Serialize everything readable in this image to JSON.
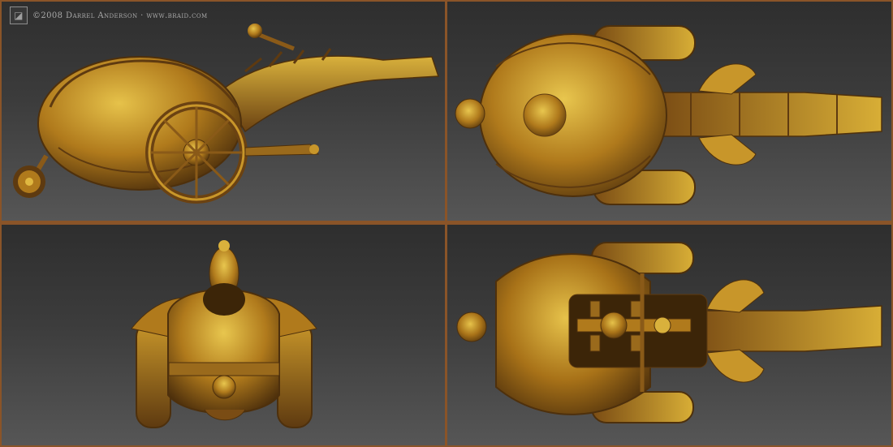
{
  "credit": {
    "copyright": "©2008 Darrel Anderson · www.braid.com"
  },
  "views": [
    {
      "id": "side",
      "icon": "vehicle-side-view"
    },
    {
      "id": "top",
      "icon": "vehicle-top-view"
    },
    {
      "id": "front",
      "icon": "vehicle-front-view"
    },
    {
      "id": "bottom",
      "icon": "vehicle-underside-view"
    }
  ],
  "colors": {
    "border": "#8a5428",
    "viewport_top": "#2e2e2e",
    "viewport_bottom": "#565656",
    "brass_light": "#d9b13c",
    "brass_mid": "#b07a1c",
    "brass_dark": "#5e3a10",
    "credit_text": "#a9a9a9"
  }
}
